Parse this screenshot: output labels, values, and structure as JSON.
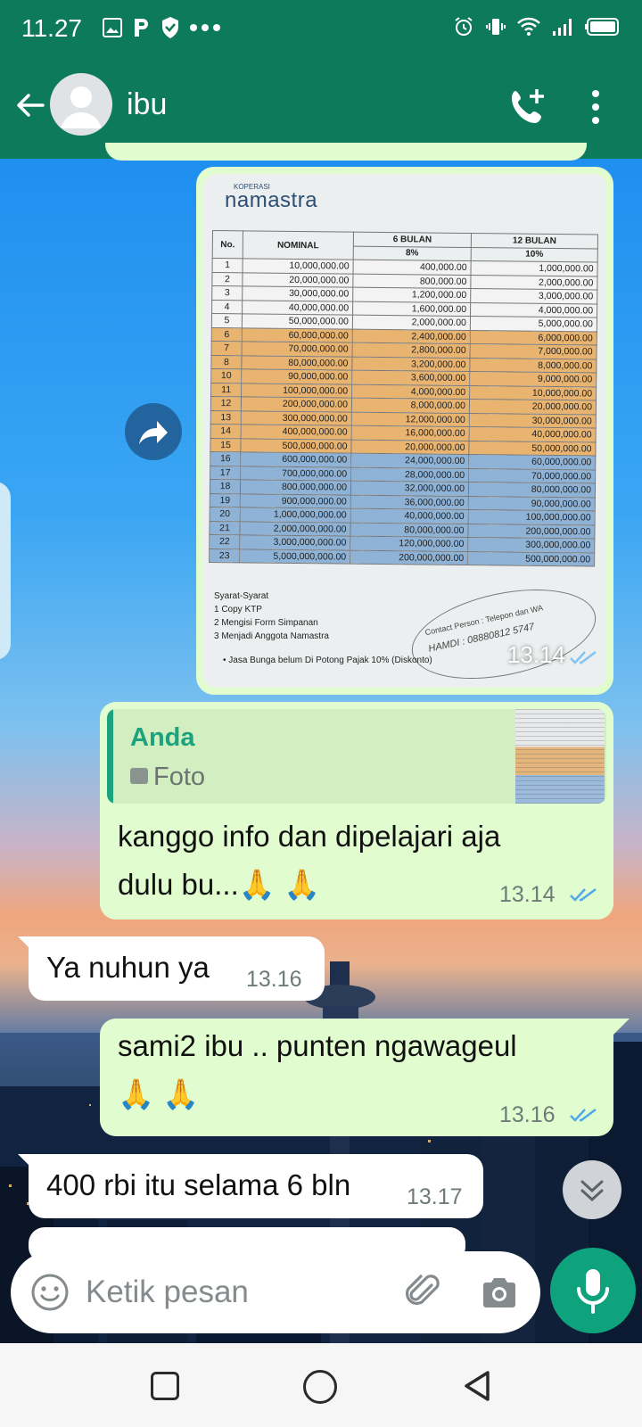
{
  "status_bar": {
    "time": "11.27",
    "left_icons": [
      "gallery-icon",
      "parking-app-icon",
      "shield-icon",
      "more-dots-icon"
    ],
    "right_icons": [
      "alarm-icon",
      "vibrate-icon",
      "wifi-icon",
      "signal-icon",
      "battery-icon"
    ]
  },
  "header": {
    "contact_name": "ibu",
    "back_icon": "arrow-back-icon",
    "call_icon": "add-call-icon",
    "menu_icon": "more-vert-icon",
    "color": "#0e7a5c"
  },
  "photo_message": {
    "time": "13.14",
    "document": {
      "logo_small": "KOPERASI",
      "logo": "namastra",
      "headers": {
        "no": "No.",
        "nominal": "NOMINAL",
        "period_6": "6 BULAN",
        "period_12": "12 BULAN",
        "rate_6": "8%",
        "rate_12": "10%"
      },
      "rows": [
        [
          "1",
          "10,000,000.00",
          "400,000.00",
          "1,000,000.00"
        ],
        [
          "2",
          "20,000,000.00",
          "800,000.00",
          "2,000,000.00"
        ],
        [
          "3",
          "30,000,000.00",
          "1,200,000.00",
          "3,000,000.00"
        ],
        [
          "4",
          "40,000,000.00",
          "1,600,000.00",
          "4,000,000.00"
        ],
        [
          "5",
          "50,000,000.00",
          "2,000,000.00",
          "5,000,000.00"
        ],
        [
          "6",
          "60,000,000.00",
          "2,400,000.00",
          "6,000,000.00"
        ],
        [
          "7",
          "70,000,000.00",
          "2,800,000.00",
          "7,000,000.00"
        ],
        [
          "8",
          "80,000,000.00",
          "3,200,000.00",
          "8,000,000.00"
        ],
        [
          "10",
          "90,000,000.00",
          "3,600,000.00",
          "9,000,000.00"
        ],
        [
          "11",
          "100,000,000.00",
          "4,000,000.00",
          "10,000,000.00"
        ],
        [
          "12",
          "200,000,000.00",
          "8,000,000.00",
          "20,000,000.00"
        ],
        [
          "13",
          "300,000,000.00",
          "12,000,000.00",
          "30,000,000.00"
        ],
        [
          "14",
          "400,000,000.00",
          "16,000,000.00",
          "40,000,000.00"
        ],
        [
          "15",
          "500,000,000.00",
          "20,000,000.00",
          "50,000,000.00"
        ],
        [
          "16",
          "600,000,000.00",
          "24,000,000.00",
          "60,000,000.00"
        ],
        [
          "17",
          "700,000,000.00",
          "28,000,000.00",
          "70,000,000.00"
        ],
        [
          "18",
          "800,000,000.00",
          "32,000,000.00",
          "80,000,000.00"
        ],
        [
          "19",
          "900,000,000.00",
          "36,000,000.00",
          "90,000,000.00"
        ],
        [
          "20",
          "1,000,000,000.00",
          "40,000,000.00",
          "100,000,000.00"
        ],
        [
          "21",
          "2,000,000,000.00",
          "80,000,000.00",
          "200,000,000.00"
        ],
        [
          "22",
          "3,000,000,000.00",
          "120,000,000.00",
          "300,000,000.00"
        ],
        [
          "23",
          "5,000,000,000.00",
          "200,000,000.00",
          "500,000,000.00"
        ]
      ],
      "terms_title": "Syarat-Syarat",
      "terms": [
        "1    Copy KTP",
        "2    Mengisi Form Simpanan",
        "3    Menjadi Anggota  Namastra"
      ],
      "contact_stamp": "Contact Person : Telepon dan WA",
      "contact_handwritten": "HAMDI : 08880812 5747",
      "note": "•     Jasa Bunga belum Di Potong Pajak 10% (Diskonto)"
    }
  },
  "reply_message": {
    "quote_sender": "Anda",
    "quote_type": "Foto",
    "text_line1": "kanggo info dan dipelajari aja",
    "text_line2": "dulu bu...🙏 🙏",
    "time": "13.14"
  },
  "incoming_1": {
    "text": "Ya nuhun ya",
    "time": "13.16"
  },
  "outgoing_2": {
    "text_line1": "sami2 ibu .. punten  ngawageul",
    "text_line2": "🙏 🙏",
    "time": "13.16"
  },
  "incoming_2": {
    "text": "400 rbi itu selama 6 bln",
    "time": "13.17"
  },
  "input": {
    "placeholder": "Ketik pesan",
    "emoji_icon": "emoji-icon",
    "attach_icon": "paperclip-icon",
    "camera_icon": "camera-icon",
    "mic_icon": "mic-icon"
  },
  "colors": {
    "outgoing_bubble": "#e1fdcf",
    "incoming_bubble": "#ffffff",
    "accent": "#0fa37d",
    "read_ticks": "#4fa9e8"
  }
}
